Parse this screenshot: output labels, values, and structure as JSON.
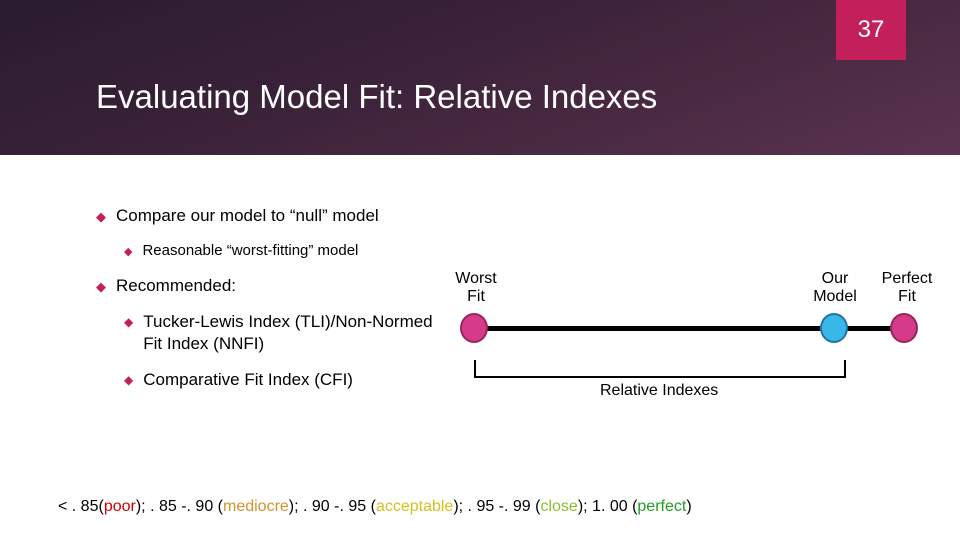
{
  "page_number": "37",
  "title": "Evaluating Model Fit: Relative Indexes",
  "bullets": {
    "compare": "Compare our model to “null” model",
    "reasonable": "Reasonable “worst-fitting” model",
    "recommended": "Recommended:",
    "tli": "Tucker-Lewis Index (TLI)/Non-Normed Fit Index (NNFI)",
    "cfi": "Comparative Fit Index (CFI)"
  },
  "diagram": {
    "worst_label": "Worst Fit",
    "our_label": "Our Model",
    "perfect_label": "Perfect Fit",
    "bracket_label": "Relative Indexes"
  },
  "scale": {
    "s1a": "< . 85(",
    "s1b": "poor",
    "s2a": "); . 85 -. 90 (",
    "s2b": "mediocre",
    "s3a": "); . 90 -. 95 (",
    "s3b": "acceptable",
    "s4a": "); . 95 -. 99 (",
    "s4b": "close",
    "s5a": "); 1. 00 (",
    "s5b": "perfect",
    "s6": ")"
  }
}
